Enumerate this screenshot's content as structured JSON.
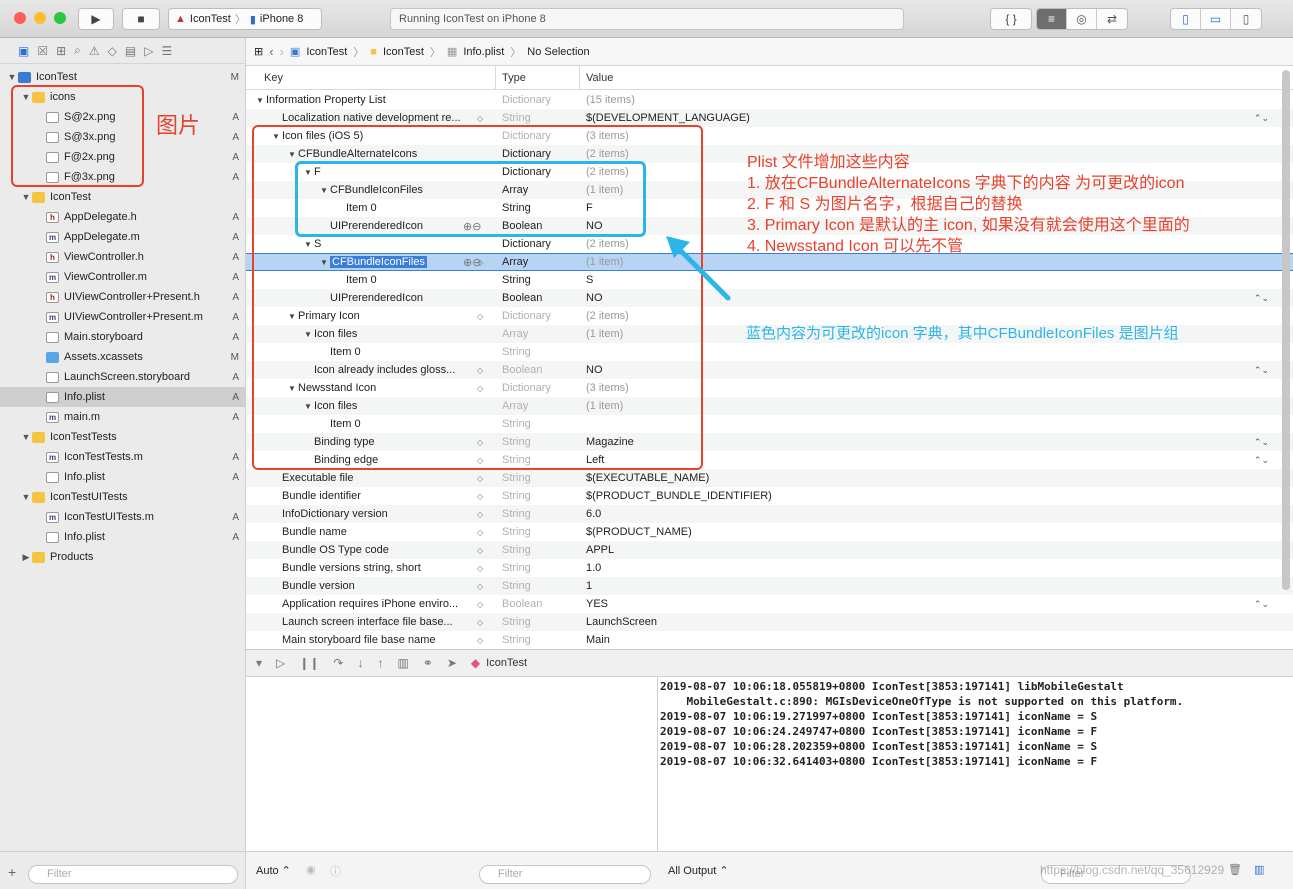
{
  "toolbar": {
    "scheme_app": "IconTest",
    "scheme_device": "iPhone 8",
    "status": "Running IconTest on iPhone 8",
    "braces": "{ }"
  },
  "navigator": {
    "items": [
      {
        "label": "IconTest",
        "level": 0,
        "icon": "project",
        "disc": "▼",
        "badge": "M"
      },
      {
        "label": "icons",
        "level": 1,
        "icon": "folder",
        "disc": "▼",
        "badge": ""
      },
      {
        "label": "S@2x.png",
        "level": 2,
        "icon": "png",
        "disc": "",
        "badge": "A"
      },
      {
        "label": "S@3x.png",
        "level": 2,
        "icon": "png",
        "disc": "",
        "badge": "A"
      },
      {
        "label": "F@2x.png",
        "level": 2,
        "icon": "png",
        "disc": "",
        "badge": "A"
      },
      {
        "label": "F@3x.png",
        "level": 2,
        "icon": "png",
        "disc": "",
        "badge": "A"
      },
      {
        "label": "IconTest",
        "level": 1,
        "icon": "folder",
        "disc": "▼",
        "badge": ""
      },
      {
        "label": "AppDelegate.h",
        "level": 2,
        "icon": "h",
        "disc": "",
        "badge": "A"
      },
      {
        "label": "AppDelegate.m",
        "level": 2,
        "icon": "m",
        "disc": "",
        "badge": "A"
      },
      {
        "label": "ViewController.h",
        "level": 2,
        "icon": "h",
        "disc": "",
        "badge": "A"
      },
      {
        "label": "ViewController.m",
        "level": 2,
        "icon": "m",
        "disc": "",
        "badge": "A"
      },
      {
        "label": "UIViewController+Present.h",
        "level": 2,
        "icon": "h",
        "disc": "",
        "badge": "A"
      },
      {
        "label": "UIViewController+Present.m",
        "level": 2,
        "icon": "m",
        "disc": "",
        "badge": "A"
      },
      {
        "label": "Main.storyboard",
        "level": 2,
        "icon": "sb",
        "disc": "",
        "badge": "A"
      },
      {
        "label": "Assets.xcassets",
        "level": 2,
        "icon": "xc",
        "disc": "",
        "badge": "M"
      },
      {
        "label": "LaunchScreen.storyboard",
        "level": 2,
        "icon": "sb",
        "disc": "",
        "badge": "A"
      },
      {
        "label": "Info.plist",
        "level": 2,
        "icon": "pl",
        "disc": "",
        "badge": "A",
        "selected": true
      },
      {
        "label": "main.m",
        "level": 2,
        "icon": "m",
        "disc": "",
        "badge": "A"
      },
      {
        "label": "IconTestTests",
        "level": 1,
        "icon": "folder",
        "disc": "▼",
        "badge": ""
      },
      {
        "label": "IconTestTests.m",
        "level": 2,
        "icon": "m",
        "disc": "",
        "badge": "A"
      },
      {
        "label": "Info.plist",
        "level": 2,
        "icon": "pl",
        "disc": "",
        "badge": "A"
      },
      {
        "label": "IconTestUITests",
        "level": 1,
        "icon": "folder",
        "disc": "▼",
        "badge": ""
      },
      {
        "label": "IconTestUITests.m",
        "level": 2,
        "icon": "m",
        "disc": "",
        "badge": "A"
      },
      {
        "label": "Info.plist",
        "level": 2,
        "icon": "pl",
        "disc": "",
        "badge": "A"
      },
      {
        "label": "Products",
        "level": 1,
        "icon": "folder",
        "disc": "▶",
        "badge": ""
      }
    ],
    "filter_placeholder": "Filter"
  },
  "jumpbar": {
    "project": "IconTest",
    "folder": "IconTest",
    "file": "Info.plist",
    "selection": "No Selection"
  },
  "plist": {
    "headers": {
      "key": "Key",
      "type": "Type",
      "value": "Value"
    },
    "rows": [
      {
        "k": "Information Property List",
        "lv": 0,
        "d": "▼",
        "t": "Dictionary",
        "tg": true,
        "v": "(15 items)",
        "vg": true
      },
      {
        "k": "Localization native development re...",
        "lv": 1,
        "d": "",
        "t": "String",
        "tg": true,
        "v": "$(DEVELOPMENT_LANGUAGE)",
        "st": true,
        "rs": true
      },
      {
        "k": "Icon files (iOS 5)",
        "lv": 1,
        "d": "▼",
        "t": "Dictionary",
        "tg": true,
        "v": "(3 items)",
        "vg": true
      },
      {
        "k": "CFBundleAlternateIcons",
        "lv": 2,
        "d": "▼",
        "t": "Dictionary",
        "v": "(2 items)",
        "vg": true
      },
      {
        "k": "F",
        "lv": 3,
        "d": "▼",
        "t": "Dictionary",
        "v": "(2 items)",
        "vg": true
      },
      {
        "k": "CFBundleIconFiles",
        "lv": 4,
        "d": "▼",
        "t": "Array",
        "v": "(1 item)",
        "vg": true
      },
      {
        "k": "Item 0",
        "lv": 5,
        "d": "",
        "t": "String",
        "v": "F"
      },
      {
        "k": "UIPrerenderedIcon",
        "lv": 4,
        "d": "",
        "t": "Boolean",
        "v": "NO",
        "pm": true
      },
      {
        "k": "S",
        "lv": 3,
        "d": "▼",
        "t": "Dictionary",
        "v": "(2 items)",
        "vg": true
      },
      {
        "k": "CFBundleIconFiles",
        "lv": 4,
        "d": "▼",
        "t": "Array",
        "v": "(1 item)",
        "vg": true,
        "sel": true,
        "pm": true,
        "st": true
      },
      {
        "k": "Item 0",
        "lv": 5,
        "d": "",
        "t": "String",
        "v": "S"
      },
      {
        "k": "UIPrerenderedIcon",
        "lv": 4,
        "d": "",
        "t": "Boolean",
        "v": "NO",
        "rs": true
      },
      {
        "k": "Primary Icon",
        "lv": 2,
        "d": "▼",
        "t": "Dictionary",
        "tg": true,
        "v": "(2 items)",
        "vg": true,
        "st": true
      },
      {
        "k": "Icon files",
        "lv": 3,
        "d": "▼",
        "t": "Array",
        "tg": true,
        "v": "(1 item)",
        "vg": true
      },
      {
        "k": "Item 0",
        "lv": 4,
        "d": "",
        "t": "String",
        "tg": true,
        "v": ""
      },
      {
        "k": "Icon already includes gloss...",
        "lv": 3,
        "d": "",
        "t": "Boolean",
        "tg": true,
        "v": "NO",
        "st": true,
        "rs": true
      },
      {
        "k": "Newsstand Icon",
        "lv": 2,
        "d": "▼",
        "t": "Dictionary",
        "tg": true,
        "v": "(3 items)",
        "vg": true,
        "st": true
      },
      {
        "k": "Icon files",
        "lv": 3,
        "d": "▼",
        "t": "Array",
        "tg": true,
        "v": "(1 item)",
        "vg": true
      },
      {
        "k": "Item 0",
        "lv": 4,
        "d": "",
        "t": "String",
        "tg": true,
        "v": ""
      },
      {
        "k": "Binding type",
        "lv": 3,
        "d": "",
        "t": "String",
        "tg": true,
        "v": "Magazine",
        "st": true,
        "rs": true
      },
      {
        "k": "Binding edge",
        "lv": 3,
        "d": "",
        "t": "String",
        "tg": true,
        "v": "Left",
        "st": true,
        "rs": true
      },
      {
        "k": "Executable file",
        "lv": 1,
        "d": "",
        "t": "String",
        "tg": true,
        "v": "$(EXECUTABLE_NAME)",
        "st": true
      },
      {
        "k": "Bundle identifier",
        "lv": 1,
        "d": "",
        "t": "String",
        "tg": true,
        "v": "$(PRODUCT_BUNDLE_IDENTIFIER)",
        "st": true
      },
      {
        "k": "InfoDictionary version",
        "lv": 1,
        "d": "",
        "t": "String",
        "tg": true,
        "v": "6.0",
        "st": true
      },
      {
        "k": "Bundle name",
        "lv": 1,
        "d": "",
        "t": "String",
        "tg": true,
        "v": "$(PRODUCT_NAME)",
        "st": true
      },
      {
        "k": "Bundle OS Type code",
        "lv": 1,
        "d": "",
        "t": "String",
        "tg": true,
        "v": "APPL",
        "st": true
      },
      {
        "k": "Bundle versions string, short",
        "lv": 1,
        "d": "",
        "t": "String",
        "tg": true,
        "v": "1.0",
        "st": true
      },
      {
        "k": "Bundle version",
        "lv": 1,
        "d": "",
        "t": "String",
        "tg": true,
        "v": "1",
        "st": true
      },
      {
        "k": "Application requires iPhone enviro...",
        "lv": 1,
        "d": "",
        "t": "Boolean",
        "tg": true,
        "v": "YES",
        "st": true,
        "rs": true
      },
      {
        "k": "Launch screen interface file base...",
        "lv": 1,
        "d": "",
        "t": "String",
        "tg": true,
        "v": "LaunchScreen",
        "st": true
      },
      {
        "k": "Main storyboard file base name",
        "lv": 1,
        "d": "",
        "t": "String",
        "tg": true,
        "v": "Main",
        "st": true
      }
    ]
  },
  "annotations": {
    "images_label": "图片",
    "notes": [
      "Plist 文件增加这些内容",
      "1. 放在CFBundleAlternateIcons 字典下的内容 为可更改的icon",
      "2. F 和 S 为图片名字，根据自己的替换",
      "3. Primary Icon 是默认的主 icon, 如果没有就会使用这个里面的",
      "4. Newsstand Icon 可以先不管"
    ],
    "blue_note": "蓝色内容为可更改的icon 字典，其中CFBundleIconFiles 是图片组"
  },
  "debugbar": {
    "target": "IconTest"
  },
  "console_lines": [
    "2019-08-07 10:06:18.055819+0800 IconTest[3853:197141] libMobileGestalt",
    "    MobileGestalt.c:890: MGIsDeviceOneOfType is not supported on this platform.",
    "2019-08-07 10:06:19.271997+0800 IconTest[3853:197141] iconName = S",
    "2019-08-07 10:06:24.249747+0800 IconTest[3853:197141] iconName = F",
    "2019-08-07 10:06:28.202359+0800 IconTest[3853:197141] iconName = S",
    "2019-08-07 10:06:32.641403+0800 IconTest[3853:197141] iconName = F"
  ],
  "bottom": {
    "auto": "Auto ⌃",
    "filter": "Filter",
    "output": "All Output ⌃",
    "filter2": "Filter"
  },
  "watermark": "https://blog.csdn.net/qq_35612929"
}
